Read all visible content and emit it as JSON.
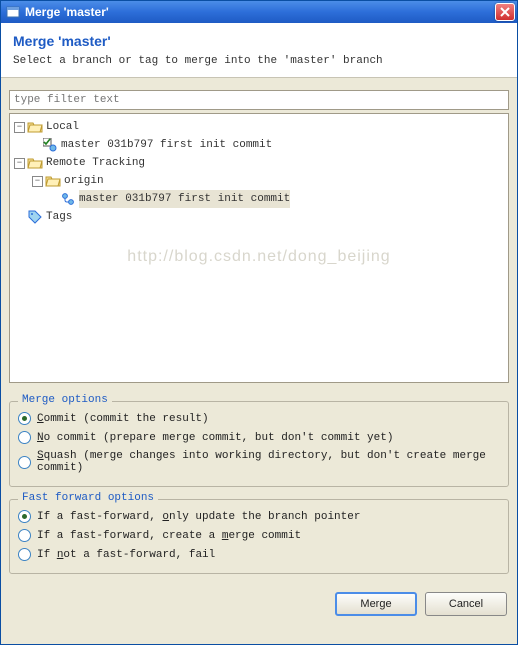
{
  "titlebar": {
    "text": "Merge 'master'"
  },
  "header": {
    "title": "Merge 'master'",
    "subtitle": "Select a branch or tag to merge into the 'master' branch"
  },
  "filter": {
    "placeholder": "type filter text"
  },
  "tree": {
    "local": {
      "label": "Local",
      "item": "master 031b797 first init commit"
    },
    "remote": {
      "label": "Remote Tracking",
      "origin": "origin",
      "item": "master 031b797 first init commit"
    },
    "tags": {
      "label": "Tags"
    }
  },
  "watermark": "http://blog.csdn.net/dong_beijing",
  "mergeOptions": {
    "title": "Merge options",
    "commit": {
      "l1": "C",
      "l2": "ommit (commit the result)"
    },
    "nocommit": {
      "l1": "N",
      "l2": "o commit (prepare merge commit, but don't commit yet)"
    },
    "squash": {
      "l1": "S",
      "l2": "quash (merge changes into working directory, but don't create merge commit)"
    }
  },
  "ffOptions": {
    "title": "Fast forward options",
    "ff": {
      "p1": "If a fast-forward, ",
      "u": "o",
      "p2": "nly update the branch pointer"
    },
    "noff": {
      "p1": "If a fast-forward, create a ",
      "u": "m",
      "p2": "erge commit"
    },
    "ffonly": {
      "p1": "If ",
      "u": "n",
      "p2": "ot a fast-forward, fail"
    }
  },
  "buttons": {
    "merge": "Merge",
    "cancel": "Cancel"
  }
}
